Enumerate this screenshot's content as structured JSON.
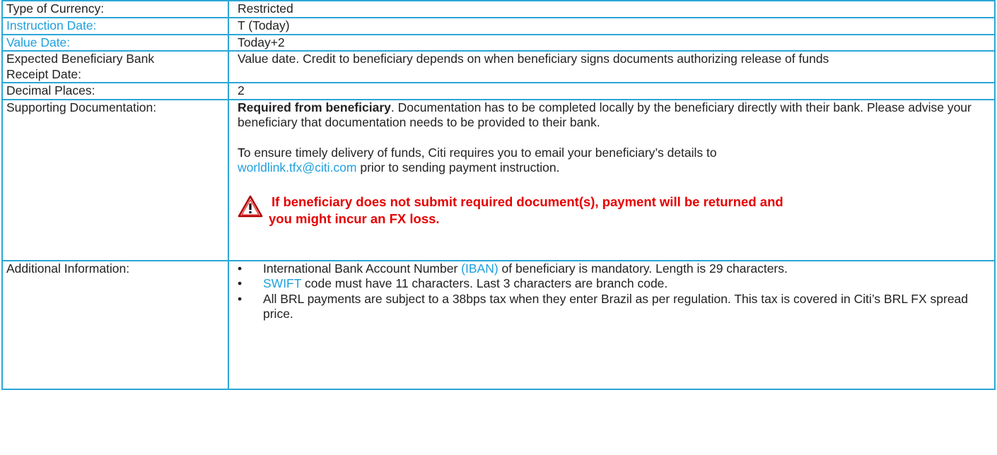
{
  "rows": {
    "currency": {
      "label": "Type of Currency:",
      "value": "Restricted"
    },
    "instruction_date": {
      "label": "Instruction Date:",
      "value": "T (Today)"
    },
    "value_date": {
      "label": "Value Date:",
      "value": "Today+2"
    },
    "receipt_date": {
      "label_line1": "Expected Beneficiary Bank",
      "label_line2": "Receipt Date:",
      "value": "Value date. Credit to beneficiary depends on when beneficiary signs documents authorizing release of funds"
    },
    "decimal_places": {
      "label": "Decimal Places:",
      "value": "2"
    },
    "supporting_docs": {
      "label": "Supporting Documentation:",
      "bold_lead": "Required from beneficiary",
      "para1_rest": ". Documentation has to be completed locally by the beneficiary directly with their bank. Please advise your beneficiary that documentation needs to be provided to their bank.",
      "para2_first_letter": "T",
      "para2_text": "o ensure timely delivery of funds, Citi requires you to email your beneficiary’s details to ",
      "email": "worldlink.tfx@citi.com",
      "para2_tail": " prior to sending payment instruction.",
      "warning_line1": "If beneficiary does not submit required document(s), payment will be returned and",
      "warning_line2": "you might incur an FX loss."
    },
    "additional_info": {
      "label": "Additional Information:",
      "bullet1_pre": "International Bank Account Number ",
      "bullet1_link": "(IBAN)",
      "bullet1_post": " of beneficiary is mandatory. Length is 29 characters.",
      "bullet2_link": "SWIFT",
      "bullet2_post": " code must have 11 characters. Last 3 characters are branch code.",
      "bullet3": "All BRL payments are subject to a 38bps tax when they enter Brazil as per regulation. This tax is covered in Citi’s BRL FX spread price."
    }
  },
  "colors": {
    "border": "#2aa7d6",
    "link": "#1ea0de",
    "warning": "#e60000"
  },
  "icons": {
    "warning": "warning-triangle-icon"
  }
}
